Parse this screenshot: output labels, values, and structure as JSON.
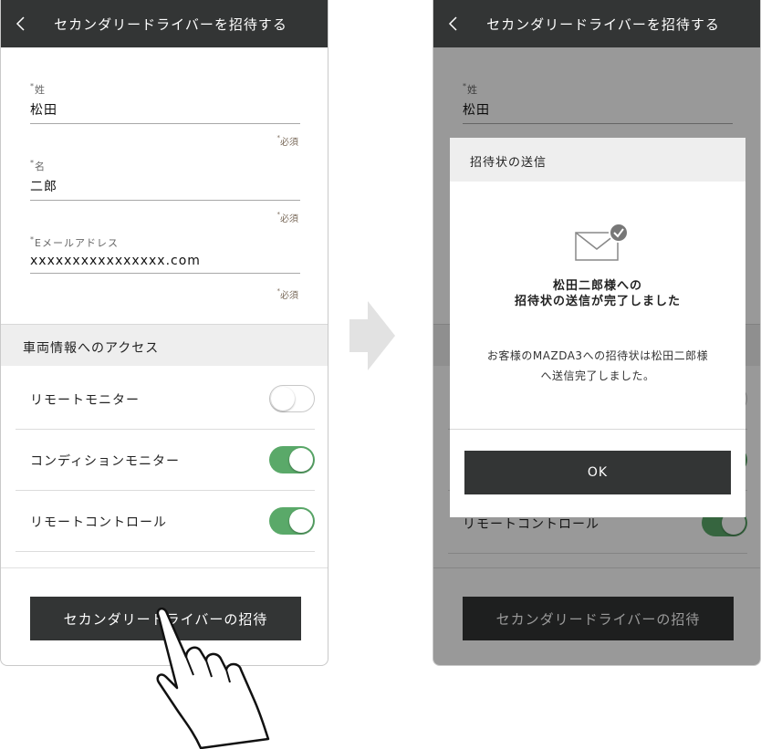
{
  "screens": {
    "left": {
      "header_title": "セカンダリードライバーを招待する",
      "fields": {
        "last_name": {
          "label": "姓",
          "value": "松田"
        },
        "first_name": {
          "label": "名",
          "value": "二郎"
        },
        "email": {
          "label": "Eメールアドレス",
          "value": "xxxxxxxxxxxxxxxx.com"
        }
      },
      "required_mark": "*",
      "required_label": "必須",
      "section_title": "車両情報へのアクセス",
      "settings": [
        {
          "label": "リモートモニター",
          "enabled": false
        },
        {
          "label": "コンディションモニター",
          "enabled": true
        },
        {
          "label": "リモートコントロール",
          "enabled": true
        }
      ],
      "invite_button": "セカンダリードライバーの招待"
    },
    "right": {
      "header_title": "セカンダリードライバーを招待する",
      "bg_last_name_label": "姓",
      "bg_last_name_value": "松田",
      "bg_setting_label": "リモートコントロール",
      "invite_button": "セカンダリードライバーの招待",
      "dialog": {
        "title": "招待状の送信",
        "message_line1": "松田二郎様への",
        "message_line2": "招待状の送信が完了しました",
        "detail_line1": "お客様のMAZDA3への招待状は松田二郎様",
        "detail_line2": "へ送信完了しました。",
        "ok_button": "OK"
      }
    }
  },
  "colors": {
    "header": "#333535",
    "toggle_on": "#5aa969",
    "section_bg": "#eeeeee",
    "overlay": "rgba(0,0,0,0.4)"
  },
  "icons": [
    "back-chevron-icon",
    "mail-sent-icon",
    "check-badge-icon",
    "next-step-arrow-icon",
    "tap-hand-icon"
  ]
}
